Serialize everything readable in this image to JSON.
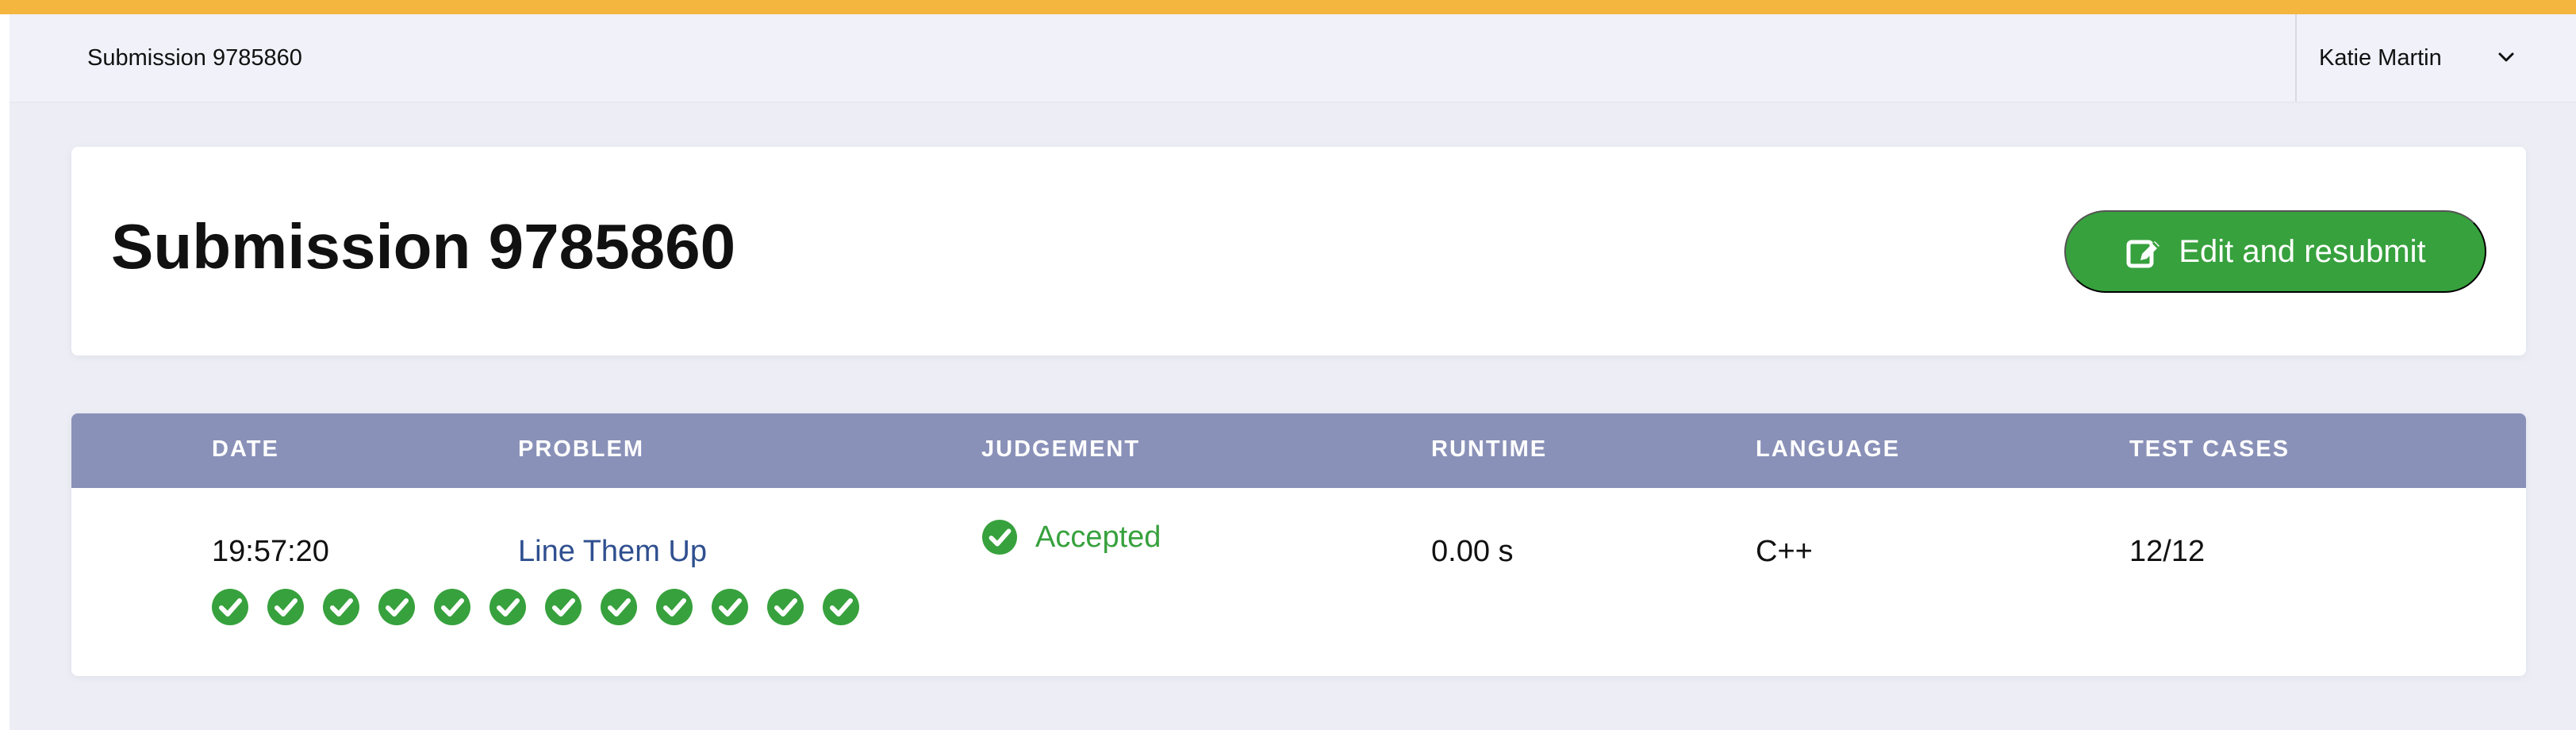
{
  "topbar": {
    "breadcrumb": "Submission 9785860",
    "user_name": "Katie Martin",
    "icons": {
      "menu_toggle": "chevron-down-icon"
    }
  },
  "page": {
    "title": "Submission 9785860",
    "action_button": {
      "label": "Edit and resubmit",
      "icon": "edit-icon"
    }
  },
  "table": {
    "headers": [
      "DATE",
      "PROBLEM",
      "JUDGEMENT",
      "RUNTIME",
      "LANGUAGE",
      "TEST CASES"
    ],
    "row": {
      "date": "19:57:20",
      "problem": "Line Them Up",
      "judgement": "Accepted",
      "runtime": "0.00 s",
      "language": "C++",
      "test_cases": "12/12"
    },
    "test_case_results": [
      "accepted",
      "accepted",
      "accepted",
      "accepted",
      "accepted",
      "accepted",
      "accepted",
      "accepted",
      "accepted",
      "accepted",
      "accepted",
      "accepted"
    ]
  },
  "colors": {
    "top_accent": "#f4b63f",
    "header_background": "#8a91b8",
    "success": "#37a13d",
    "link": "#2f4f8f"
  }
}
